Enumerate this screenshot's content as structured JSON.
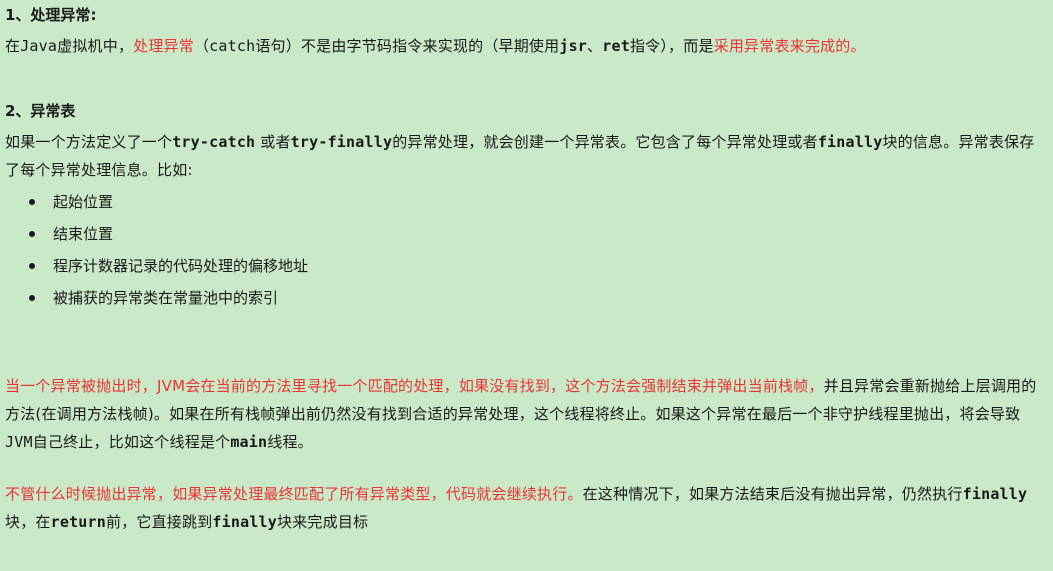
{
  "section1": {
    "heading": "1、处理异常:",
    "p1_a": "在",
    "p1_java": "Java",
    "p1_b": "虚拟机中，",
    "p1_red1": "处理异常",
    "p1_c": "（",
    "p1_catch": "catch",
    "p1_d": "语句）不是由字节码指令来实现的（早期使用",
    "p1_jsr": "jsr",
    "p1_e": "、",
    "p1_ret": "ret",
    "p1_f": "指令），而是",
    "p1_red2": "采用异常表来完成",
    "p1_g": "的。"
  },
  "section2": {
    "heading": "2、异常表",
    "p2_a": "如果一个方法定义了一个",
    "p2_trycatch": "try-catch",
    "p2_b": " 或者",
    "p2_tryfinally": "try-finally",
    "p2_c": "的异常处理，就会创建一个异常表。它包含了每个异常处理或者",
    "p2_finally": "finally",
    "p2_d": "块的信息。异常表保存了每个异常处理信息。比如:",
    "bullets": [
      "起始位置",
      "结束位置",
      "程序计数器记录的代码处理的偏移地址",
      "被捕获的异常类在常量池中的索引"
    ]
  },
  "section3": {
    "red": "当一个异常被抛出时，JVM会在当前的方法里寻找一个匹配的处理，如果没有找到，这个方法会强制结束并弹出当前栈帧，",
    "black1": "并且异常会重新抛给上层调用的方法(在调用方法栈帧)。如果在所有栈帧弹出前仍然没有找到合适的异常处理，这个线程将终止。如果这个异常在最后一个非守护线程里抛出，将会导致",
    "jvm": "JVM",
    "black2": "自己终止，比如这个线程是个",
    "main": "main",
    "black3": "线程。"
  },
  "section4": {
    "red": "不管什么时候抛出异常，如果异常处理最终匹配了所有异常类型，代码就会继续执行。",
    "black1": "在这种情况下，如果方法结束后没有抛出异常，仍然执行",
    "finally1": "finally",
    "black2": "块，在",
    "return": "return",
    "black3": "前，它直接跳到",
    "finally2": "finally",
    "black4": "块来完成目标"
  },
  "colors": {
    "background": "#c9e9c8",
    "highlight_red": "#ee3333",
    "text": "#1a1a1a"
  }
}
